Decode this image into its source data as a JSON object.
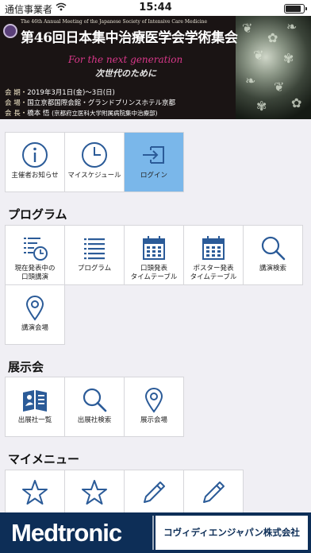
{
  "status_bar": {
    "carrier": "通信事業者",
    "time": "15:44",
    "battery_level": 0.85
  },
  "banner": {
    "annual_meeting_en": "The 46th Annual Meeting of the Japanese Society of Intensive Care Medicine",
    "title": "第46回日本集中治療医学会学術集会",
    "tagline_en": "For the next generation",
    "tagline_ja": "次世代のために",
    "dates_label": "会 期・",
    "dates": "2019年3月1日(金)〜3日(日)",
    "venue_label": "会 場・",
    "venue": "国立京都国際会館・グランドプリンスホテル京都",
    "chair_label": "会 長・",
    "chair": "橋本 悟",
    "chair_affiliation": "(京都府立医科大学附属病院集中治療部)"
  },
  "top_tiles": [
    {
      "label": "主催者お知らせ",
      "icon": "info-icon"
    },
    {
      "label": "マイスケジュール",
      "icon": "clock-icon"
    },
    {
      "label": "ログイン",
      "icon": "login-icon",
      "active": true
    }
  ],
  "sections": {
    "program": {
      "title": "プログラム",
      "tiles": [
        {
          "label": "現在発表中の\n口頭講演",
          "icon": "list-clock-icon"
        },
        {
          "label": "プログラム",
          "icon": "list-icon"
        },
        {
          "label": "口頭発表\nタイムテーブル",
          "icon": "calendar-icon"
        },
        {
          "label": "ポスター発表\nタイムテーブル",
          "icon": "calendar-icon"
        },
        {
          "label": "講演検索",
          "icon": "search-icon"
        },
        {
          "label": "講演会場",
          "icon": "map-pin-icon"
        }
      ]
    },
    "exhibition": {
      "title": "展示会",
      "tiles": [
        {
          "label": "出展社一覧",
          "icon": "exhibitor-book-icon"
        },
        {
          "label": "出展社検索",
          "icon": "search-icon"
        },
        {
          "label": "展示会場",
          "icon": "map-pin-icon"
        }
      ]
    },
    "my_menu": {
      "title": "マイメニュー",
      "tiles": [
        {
          "label": "",
          "icon": "star-icon"
        },
        {
          "label": "",
          "icon": "star-icon"
        },
        {
          "label": "",
          "icon": "pencil-icon"
        },
        {
          "label": "",
          "icon": "pencil-icon"
        }
      ]
    }
  },
  "footer": {
    "brand": "Medtronic",
    "company": "コヴィディエンジャパン株式会社"
  },
  "colors": {
    "icon": "#2b5b98",
    "active_tile": "#7ab7ea",
    "footer": "#0d2e57"
  }
}
